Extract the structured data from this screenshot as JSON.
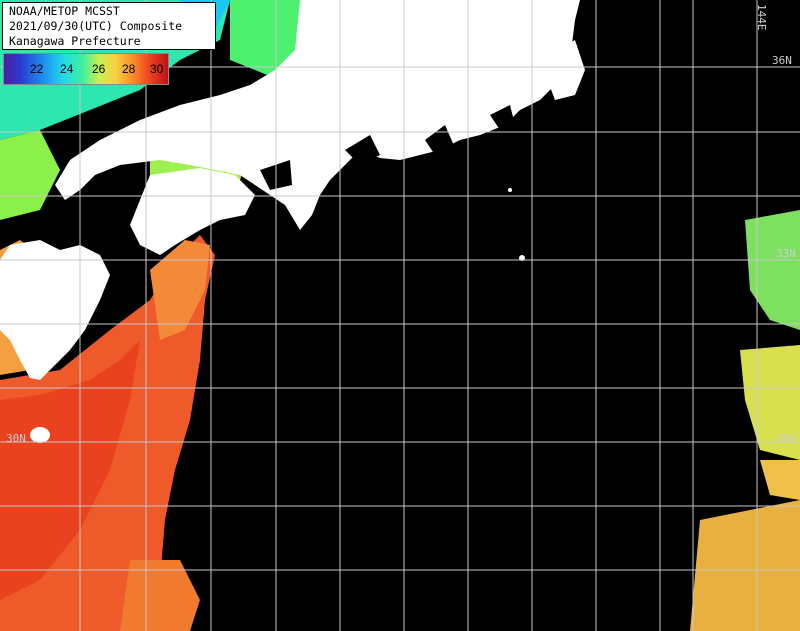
{
  "header": {
    "line1": "NOAA/METOP MCSST",
    "line2": "2021/09/30(UTC) Composite",
    "line3": "Kanagawa Prefecture"
  },
  "scale": {
    "labels": [
      "22",
      "24",
      "26",
      "28",
      "30"
    ]
  },
  "grid_labels": {
    "lat_36": "36N",
    "lat_33": "33N",
    "lat_30_left": "30N",
    "lat_30_right": "30N",
    "lon_144": "144E"
  },
  "colors": {
    "background": "#000000",
    "land": "#ffffff",
    "grid": "#c8c8c8"
  }
}
